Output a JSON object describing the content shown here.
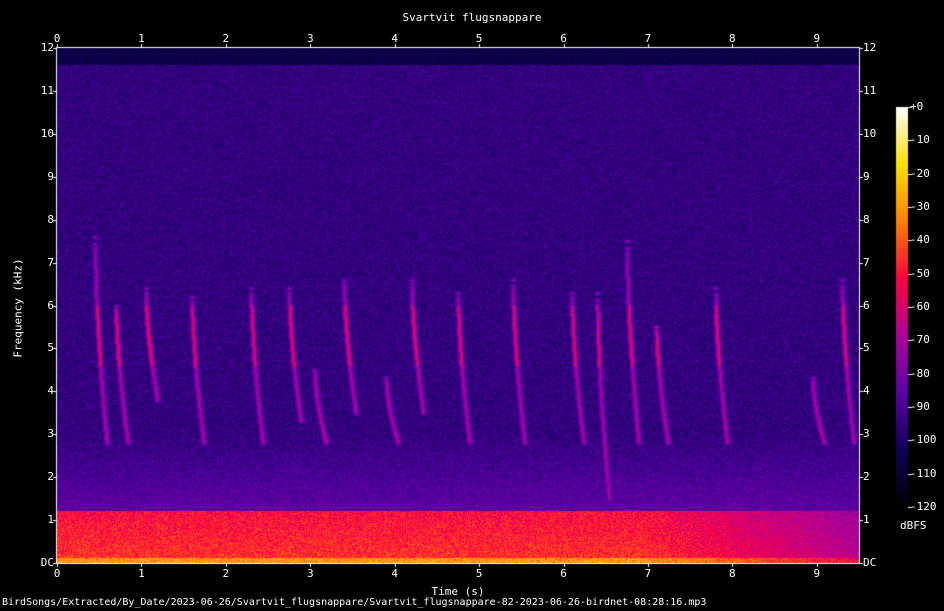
{
  "chart_data": {
    "type": "heatmap",
    "title": "Svartvit flugsnappare",
    "xlabel": "Time (s)",
    "ylabel": "Frequency (kHz)",
    "xlim": [
      0,
      9.5
    ],
    "ylim": [
      0,
      12
    ],
    "x_ticks": [
      "0",
      "1",
      "2",
      "3",
      "4",
      "5",
      "6",
      "7",
      "8",
      "9"
    ],
    "y_ticks": [
      "DC",
      "1",
      "2",
      "3",
      "4",
      "5",
      "6",
      "7",
      "8",
      "9",
      "10",
      "11",
      "12"
    ],
    "colorbar": {
      "label": "dBFS",
      "ticks": [
        "+0",
        "-10",
        "-20",
        "-30",
        "-40",
        "-50",
        "-60",
        "-70",
        "-80",
        "-90",
        "-100",
        "-110",
        "-120"
      ],
      "range": [
        -120,
        0
      ],
      "colors": [
        "#000000",
        "#10005a",
        "#5a00a8",
        "#b0009a",
        "#ff0040",
        "#ff8000",
        "#ffe000",
        "#ffffff"
      ]
    },
    "background_level_dbfs": -95,
    "low_frequency_noise_band_khz": [
      0,
      1.2
    ],
    "noise_cutoff_khz": 11.6,
    "calls": [
      {
        "t": 0.45,
        "f_high": 7.6,
        "f_low": 2.8
      },
      {
        "t": 0.7,
        "f_high": 6.0,
        "f_low": 2.8
      },
      {
        "t": 1.05,
        "f_high": 6.4,
        "f_low": 3.8
      },
      {
        "t": 1.6,
        "f_high": 6.2,
        "f_low": 2.8
      },
      {
        "t": 2.3,
        "f_high": 6.4,
        "f_low": 2.8
      },
      {
        "t": 2.75,
        "f_high": 6.4,
        "f_low": 3.3
      },
      {
        "t": 3.05,
        "f_high": 4.5,
        "f_low": 2.8
      },
      {
        "t": 3.4,
        "f_high": 6.6,
        "f_low": 3.5
      },
      {
        "t": 3.9,
        "f_high": 4.3,
        "f_low": 2.8
      },
      {
        "t": 4.2,
        "f_high": 6.6,
        "f_low": 3.5
      },
      {
        "t": 4.75,
        "f_high": 6.3,
        "f_low": 2.8
      },
      {
        "t": 5.4,
        "f_high": 6.6,
        "f_low": 2.8
      },
      {
        "t": 6.1,
        "f_high": 6.3,
        "f_low": 2.8
      },
      {
        "t": 6.4,
        "f_high": 6.3,
        "f_low": 1.5
      },
      {
        "t": 6.75,
        "f_high": 7.5,
        "f_low": 2.8
      },
      {
        "t": 7.1,
        "f_high": 5.5,
        "f_low": 2.8
      },
      {
        "t": 7.8,
        "f_high": 6.4,
        "f_low": 2.8
      },
      {
        "t": 8.95,
        "f_high": 4.3,
        "f_low": 2.8
      },
      {
        "t": 9.3,
        "f_high": 6.6,
        "f_low": 2.8
      }
    ]
  },
  "filename": "BirdSongs/Extracted/By_Date/2023-06-26/Svartvit_flugsnappare/Svartvit_flugsnappare-82-2023-06-26-birdnet-08:28:16.mp3"
}
